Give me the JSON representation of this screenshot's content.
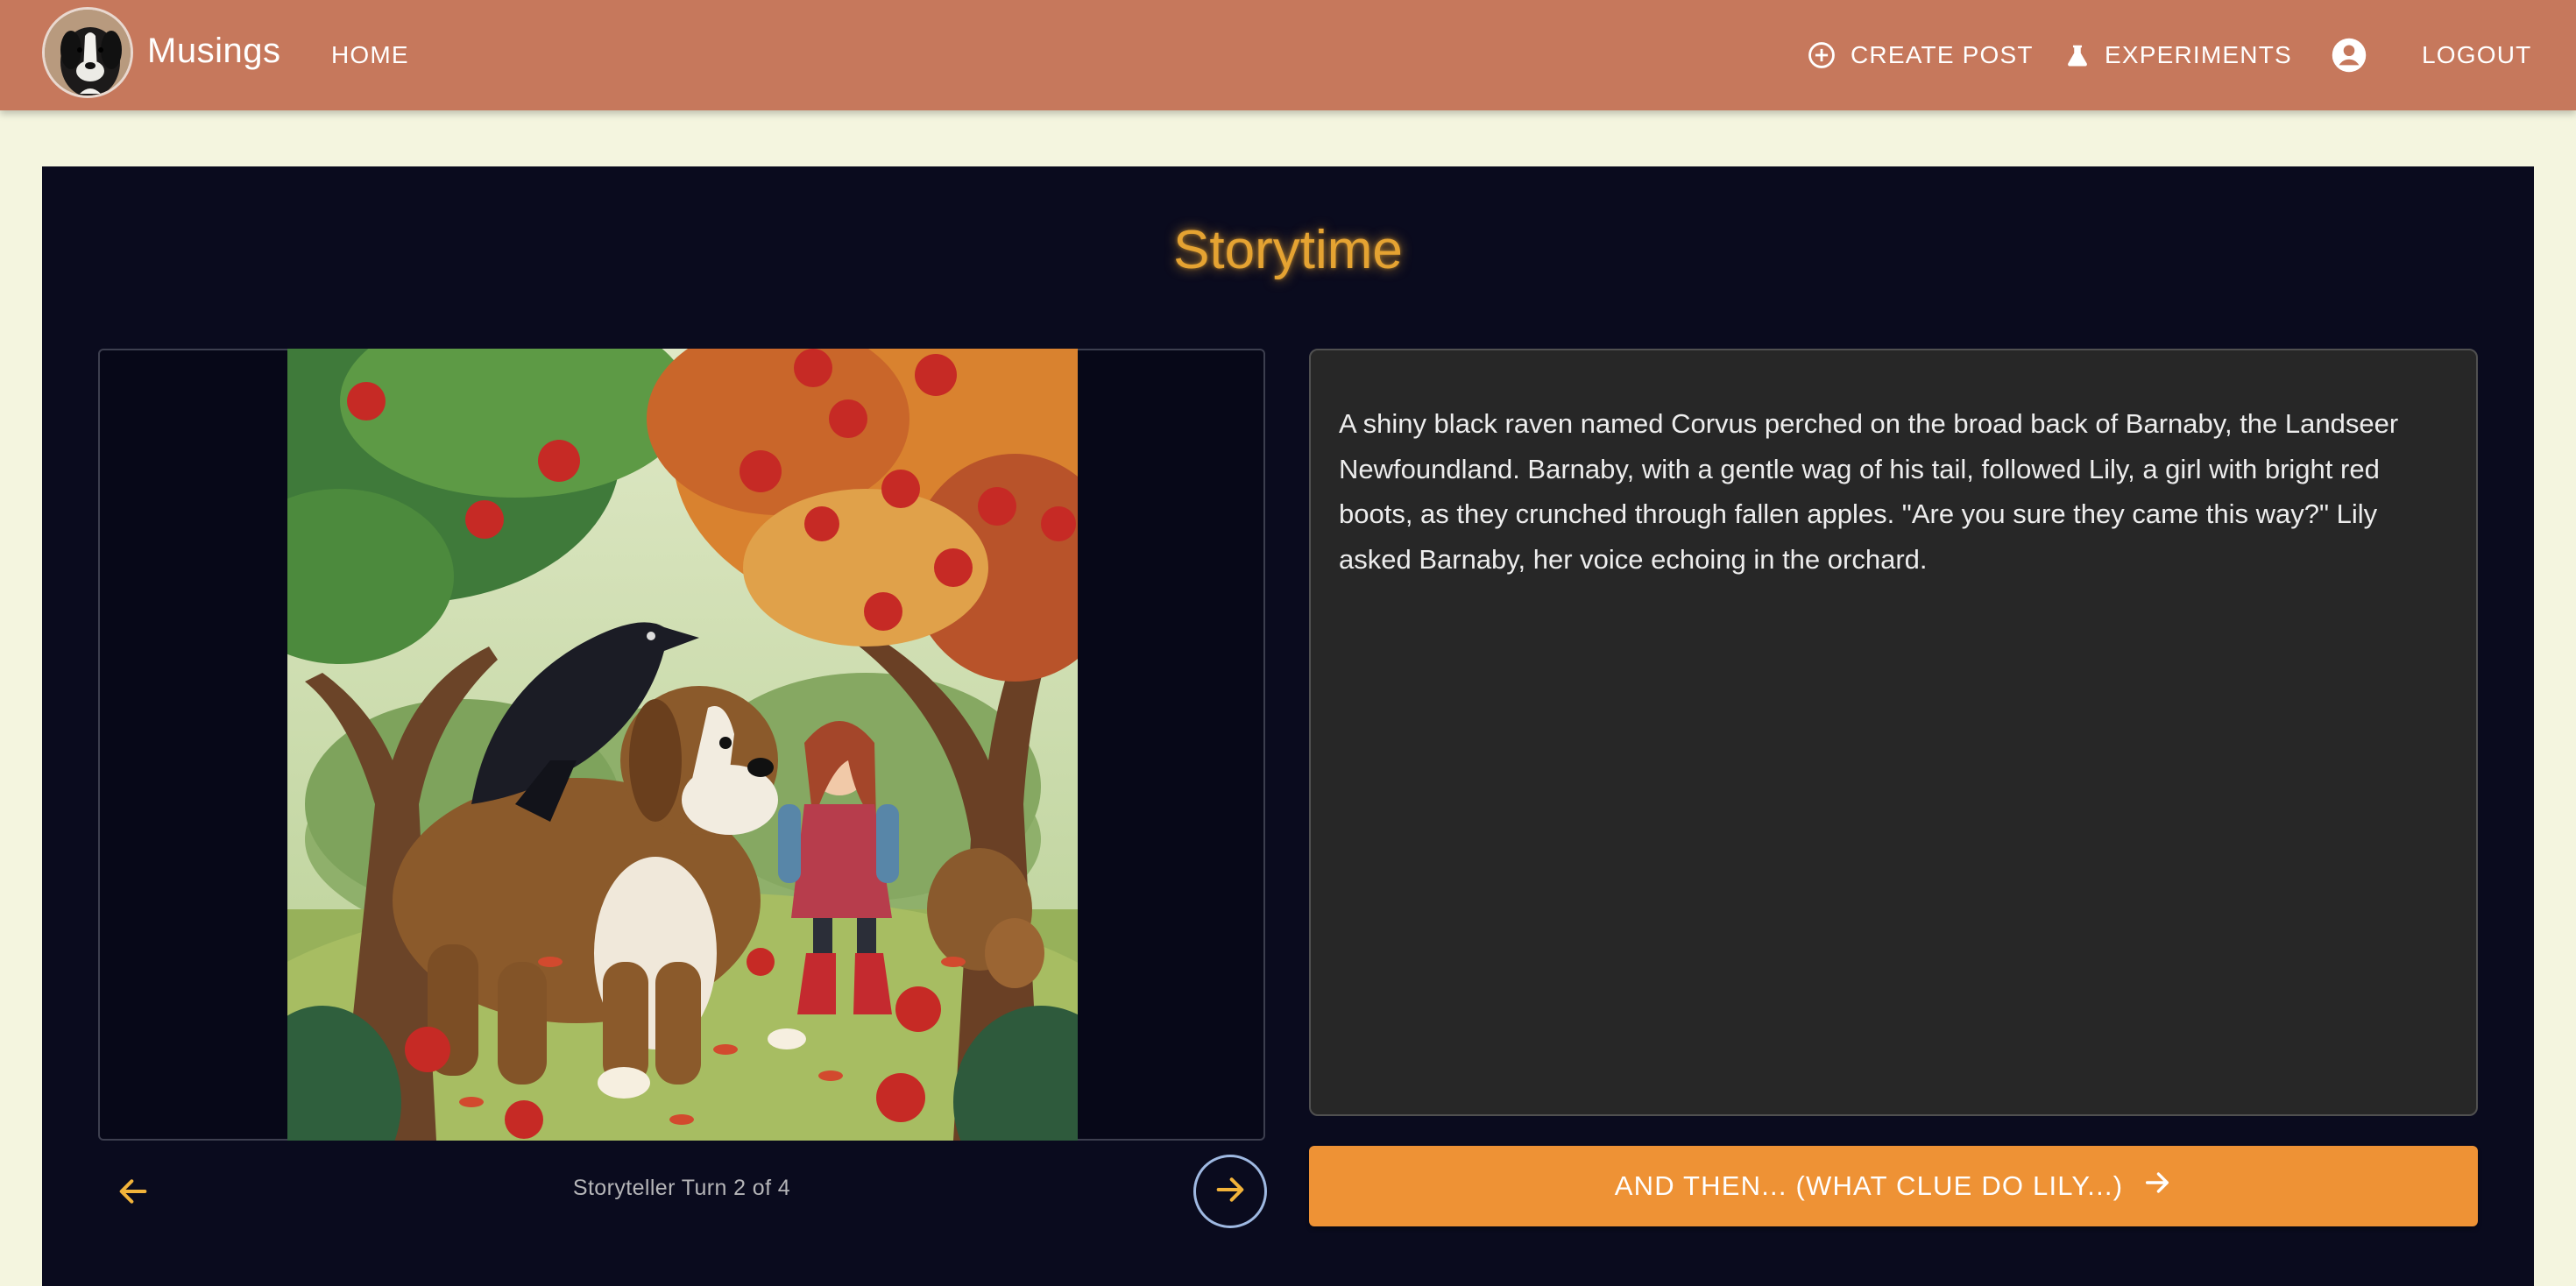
{
  "app": {
    "brand": "Musings"
  },
  "nav": {
    "home": "HOME",
    "create_post": "CREATE POST",
    "experiments": "EXPERIMENTS",
    "logout": "LOGOUT"
  },
  "icons": {
    "create_post": "add-circle-icon",
    "experiments": "flask-icon",
    "account": "account-circle-icon",
    "previous": "arrow-left-icon",
    "next": "arrow-right-icon",
    "and_then": "arrow-right-icon"
  },
  "colors": {
    "appbar": "#c6785c",
    "page_background": "#f4f5df",
    "panel": "#0a0b1e",
    "title_glow": "#e5a332",
    "story_box": "#272727",
    "primary_button": "#ee9235",
    "arrow_accent": "#f2b33a"
  },
  "story": {
    "title": "Storytime",
    "text": "A shiny black raven named Corvus perched on the broad back of Barnaby, the Landseer Newfoundland. Barnaby, with a gentle wag of his tail, followed Lily, a girl with bright red boots, as they crunched through fallen apples. \"Are you sure they came this way?\" Lily asked Barnaby, her voice echoing in the orchard.",
    "turn_label": "Storyteller Turn 2 of 4",
    "turn_current": 2,
    "turn_total": 4,
    "continue_button": "AND THEN... (WHAT CLUE DO LILY...)"
  }
}
